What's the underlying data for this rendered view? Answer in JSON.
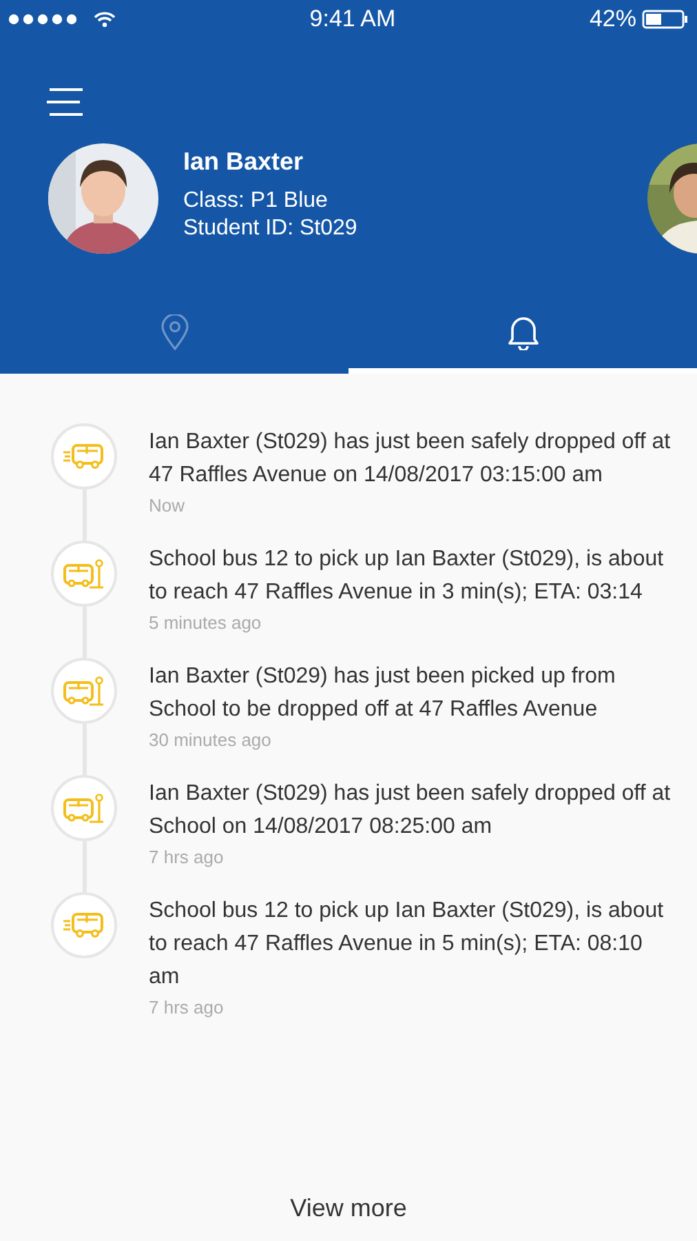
{
  "status_bar": {
    "time": "9:41 AM",
    "battery": "42%"
  },
  "profile": {
    "name": "Ian Baxter",
    "class": "Class: P1 Blue",
    "student_id": "Student ID: St029"
  },
  "tabs": [
    {
      "kind": "location",
      "selected": false
    },
    {
      "kind": "notifications",
      "selected": true
    }
  ],
  "notifications": [
    {
      "kind": "moving",
      "message": "Ian Baxter (St029) has just been safely dropped off at 47 Raffles Avenue on 14/08/2017 03:15:00 am",
      "time": "Now"
    },
    {
      "kind": "stop",
      "message": "School bus 12 to pick up Ian Baxter (St029), is about to reach 47 Raffles Avenue in 3 min(s); ETA: 03:14",
      "time": "5 minutes ago"
    },
    {
      "kind": "stop",
      "message": "Ian Baxter (St029) has just been picked up from School to be dropped off at 47 Raffles Avenue",
      "time": "30 minutes ago"
    },
    {
      "kind": "stop",
      "message": "Ian Baxter (St029) has just been safely dropped off at School on 14/08/2017 08:25:00 am",
      "time": "7 hrs ago"
    },
    {
      "kind": "moving",
      "message": "School bus 12 to pick up Ian Baxter (St029), is about to reach 47 Raffles Avenue in 5 min(s); ETA: 08:10 am",
      "time": "7 hrs ago"
    }
  ],
  "view_more": "View more"
}
